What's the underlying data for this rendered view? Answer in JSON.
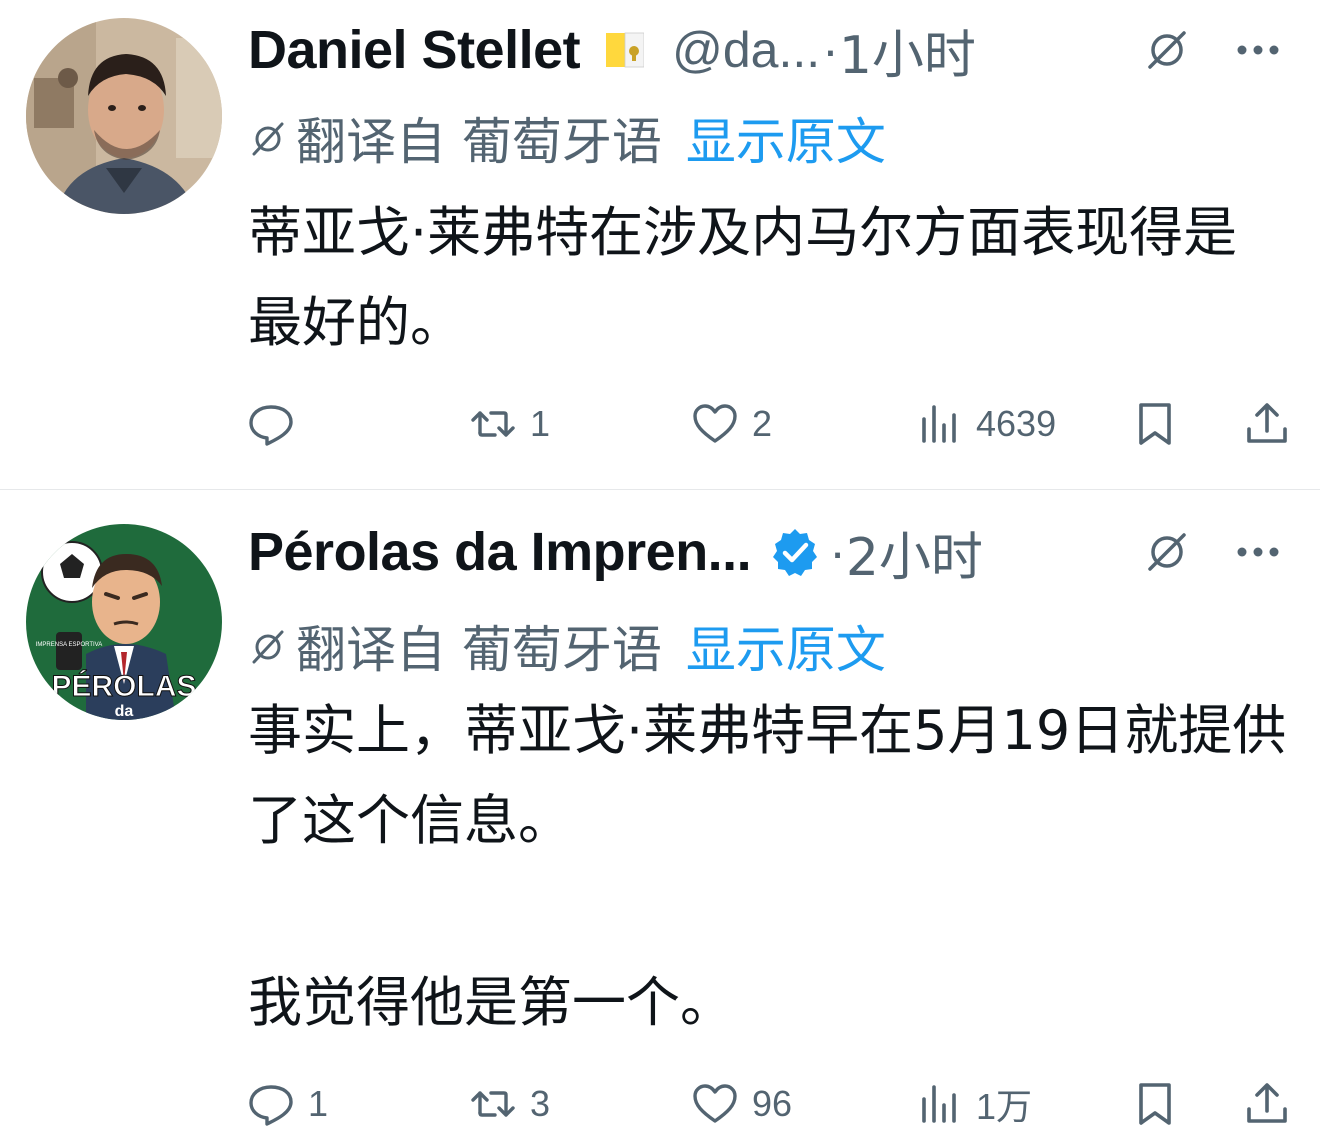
{
  "tweets": [
    {
      "author_name": "Daniel Stellet",
      "handle": "@da...",
      "separator": "·",
      "time": "1小时",
      "translation": {
        "label": "翻译自 葡萄牙语",
        "show_original": "显示原文"
      },
      "body": [
        "蒂亚戈·莱弗特在涉及内马尔方面表现得是最好的。"
      ],
      "stats": {
        "replies": "",
        "retweets": "1",
        "likes": "2",
        "views": "4639"
      },
      "badge_icon": "vatican-flag-icon"
    },
    {
      "author_name": "Pérolas da Impren...",
      "handle": "",
      "separator": "·",
      "time": "2小时",
      "translation": {
        "label": "翻译自 葡萄牙语",
        "show_original": "显示原文"
      },
      "body": [
        "事实上，蒂亚戈·莱弗特早在5月19日就提供了这个信息。",
        "我觉得他是第一个。"
      ],
      "stats": {
        "replies": "1",
        "retweets": "3",
        "likes": "96",
        "views": "1万"
      },
      "badge_icon": "verified-badge-icon",
      "avatar_text": {
        "top": "IMPRENSA ESPORTIVA",
        "main": "PÉROLAS",
        "sub": "da"
      }
    }
  ],
  "colors": {
    "primary_text": "#0f1419",
    "secondary_text": "#536471",
    "link": "#1d9bf0",
    "verified": "#1d9bf0"
  }
}
